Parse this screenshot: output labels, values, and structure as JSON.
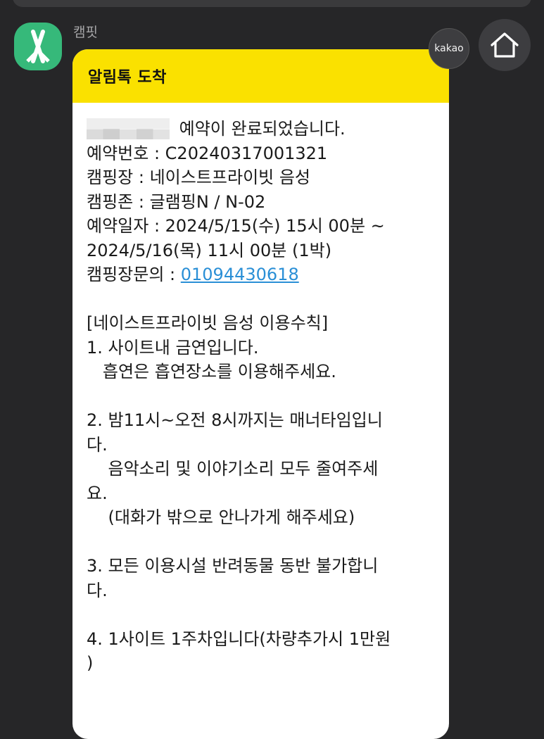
{
  "sender": {
    "name": "캠핏",
    "avatar_color": "#36b97a"
  },
  "badge": {
    "label": "kakao"
  },
  "home": {
    "icon": "home-icon"
  },
  "bubble": {
    "header_title": "알림톡 도착",
    "header_color": "#fae100",
    "first_line_rest": " 예약이 완료되었습니다.",
    "reservation_no": "예약번호 : C20240317001321",
    "campsite": "캠핑장 : 네이스트프라이빗 음성",
    "zone": "캠핑존 : 글램핑N / N-02",
    "date_line1": "예약일자 : 2024/5/15(수) 15시 00분 ~",
    "date_line2": "2024/5/16(목) 11시 00분 (1박)",
    "inquiry_label": "캠핑장문의 : ",
    "inquiry_phone": "01094430618",
    "rules_title": "[네이스트프라이빗 음성 이용수칙]",
    "rule1_line1": "1. 사이트내 금연입니다.",
    "rule1_line2": "   흡연은 흡연장소를 이용해주세요.",
    "rule2_line1": "2. 밤11시~오전 8시까지는 매너타임입니",
    "rule2_line2": "다.",
    "rule2_line3": "    음악소리 및 이야기소리 모두 줄여주세",
    "rule2_line4": "요.",
    "rule2_line5": "    (대화가 밖으로 안나가게 해주세요)",
    "rule3_line1": "3. 모든 이용시설 반려동물 동반 불가합니",
    "rule3_line2": "다.",
    "rule4_line1": "4. 1사이트 1주차입니다(차량추가시 1만원",
    "rule4_line2": ")"
  }
}
